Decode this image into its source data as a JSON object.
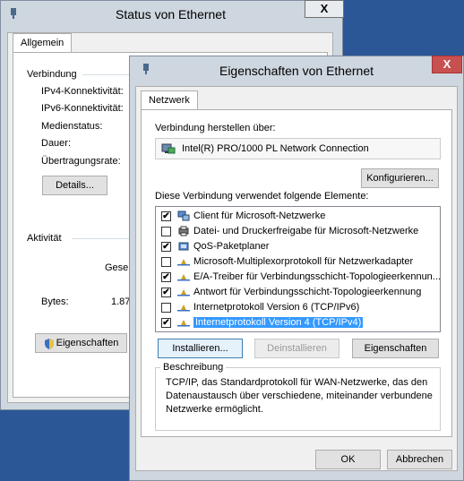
{
  "status_window": {
    "title": "Status von Ethernet",
    "close_label": "X",
    "tab": "Allgemein",
    "connection_group": "Verbindung",
    "labels": [
      "IPv4-Konnektivität:",
      "IPv6-Konnektivität:",
      "Medienstatus:",
      "Dauer:",
      "Übertragungsrate:"
    ],
    "details_button": "Details...",
    "activity_group": "Aktivität",
    "sent_partial": "Gesen",
    "bytes_label": "Bytes:",
    "bytes_partial": "1.87",
    "properties_button": "Eigenschaften"
  },
  "props_window": {
    "title": "Eigenschaften von Ethernet",
    "close_label": "X",
    "tab": "Netzwerk",
    "connect_using_label": "Verbindung herstellen über:",
    "adapter": "Intel(R) PRO/1000 PL Network Connection",
    "configure_button": "Konfigurieren...",
    "items_label": "Diese Verbindung verwendet folgende Elemente:",
    "items": [
      {
        "label": "Client für Microsoft-Netzwerke",
        "checked": "✔",
        "icon": "network-client-icon"
      },
      {
        "label": "Datei- und Druckerfreigabe für Microsoft-Netzwerke",
        "checked": "",
        "icon": "printer-share-icon"
      },
      {
        "label": "QoS-Paketplaner",
        "checked": "✔",
        "icon": "qos-icon"
      },
      {
        "label": "Microsoft-Multiplexorprotokoll für Netzwerkadapter",
        "checked": "",
        "icon": "protocol-icon"
      },
      {
        "label": "E/A-Treiber für Verbindungsschicht-Topologieerkennun...",
        "checked": "✔",
        "icon": "protocol-icon"
      },
      {
        "label": "Antwort für Verbindungsschicht-Topologieerkennung",
        "checked": "✔",
        "icon": "protocol-icon"
      },
      {
        "label": "Internetprotokoll Version 6 (TCP/IPv6)",
        "checked": "",
        "icon": "protocol-icon"
      },
      {
        "label": "Internetprotokoll Version 4 (TCP/IPv4)",
        "checked": "✔",
        "icon": "protocol-icon"
      }
    ],
    "install_button": "Installieren...",
    "uninstall_button": "Deinstallieren",
    "properties_button": "Eigenschaften",
    "description_group": "Beschreibung",
    "description_text": "TCP/IP, das Standardprotokoll für WAN-Netzwerke, das den Datenaustausch über verschiedene, miteinander verbundene Netzwerke ermöglicht.",
    "ok_button": "OK",
    "cancel_button": "Abbrechen"
  }
}
